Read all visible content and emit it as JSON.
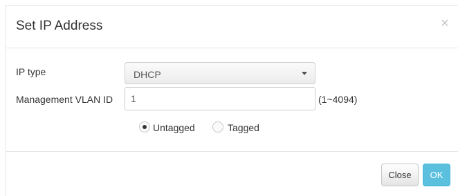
{
  "dialog": {
    "title": "Set IP Address",
    "close_glyph": "×"
  },
  "form": {
    "ip_type": {
      "label": "IP type",
      "selected": "DHCP"
    },
    "vlan": {
      "label": "Management VLAN ID",
      "value": "1",
      "range_hint": "(1~4094)"
    },
    "tagging": {
      "options": [
        "Untagged",
        "Tagged"
      ],
      "selected": "Untagged"
    }
  },
  "footer": {
    "close_label": "Close",
    "ok_label": "OK"
  },
  "colors": {
    "ok_button": "#5bc0de"
  }
}
